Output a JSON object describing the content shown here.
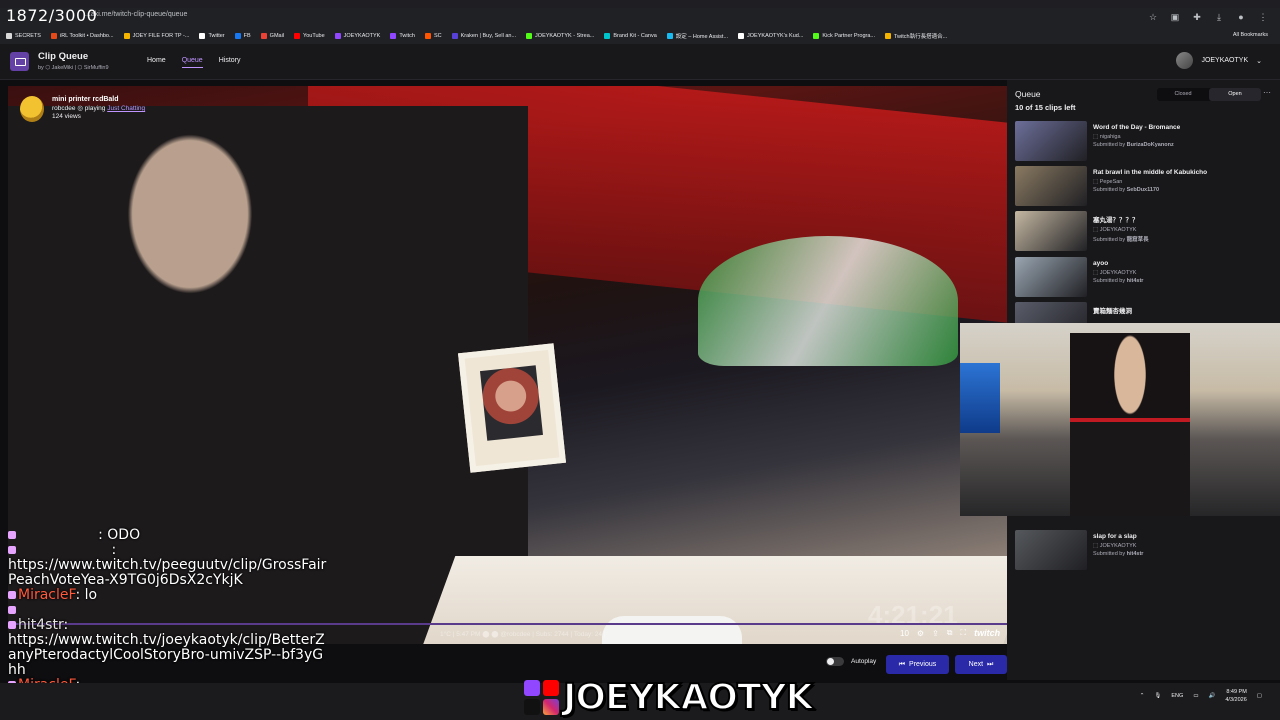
{
  "frame_counter": "1872/3000",
  "browser": {
    "url": "...aki.me/twitch-clip-queue/queue",
    "bookmarks": [
      {
        "label": "SECRETS",
        "color": "#d8d8d8"
      },
      {
        "label": "iRL Toolkit • Dashbo...",
        "color": "#e64a19"
      },
      {
        "label": "JOEY FILE FOR TP -...",
        "color": "#f5b400"
      },
      {
        "label": "Twitter",
        "color": "#ffffff"
      },
      {
        "label": "FB",
        "color": "#1877f2"
      },
      {
        "label": "GMail",
        "color": "#ea4335"
      },
      {
        "label": "YouTube",
        "color": "#ff0000"
      },
      {
        "label": "JOEYKAOTYK",
        "color": "#9146ff"
      },
      {
        "label": "Twitch",
        "color": "#9146ff"
      },
      {
        "label": "SC",
        "color": "#ff5500"
      },
      {
        "label": "Kraken | Buy, Sell an...",
        "color": "#5741d9"
      },
      {
        "label": "JOEYKAOTYK - Strea...",
        "color": "#53fc18"
      },
      {
        "label": "Brand Kit - Canva",
        "color": "#00c4cc"
      },
      {
        "label": "設定 – Home Assist...",
        "color": "#18bcf2"
      },
      {
        "label": "JOEYKAOTYK's Kud...",
        "color": "#ffffff"
      },
      {
        "label": "Kick Partner Progra...",
        "color": "#53fc18"
      },
      {
        "label": "Twitch執行長搭適合...",
        "color": "#f5b400"
      }
    ],
    "all_bookmarks": "All Bookmarks"
  },
  "app": {
    "title": "Clip Queue",
    "subtitle": "by ⬡ JakeMiki | ⬡ SirMuffin9",
    "nav": [
      {
        "label": "Home",
        "active": false
      },
      {
        "label": "Queue",
        "active": true
      },
      {
        "label": "History",
        "active": false
      }
    ],
    "user": "JOEYKAOTYK"
  },
  "player": {
    "clip_title": "mini printer rcdBald",
    "channel": "robcdee",
    "playing_prefix": "playing",
    "game": "Just Chatting",
    "views": "124 views",
    "overlay_time": "4:21:21",
    "status_strip": "1°C | 5:47 PM  ⬤  ⬤  @robcdee |  Subs: 2744  |  Today: 24  |",
    "control_count": "10",
    "brand": "twitch"
  },
  "chat": {
    "lines": [
      {
        "user": "",
        "text": "                  : ODO"
      },
      {
        "user": "                     ",
        "text": ":"
      },
      {
        "user": "",
        "text": "https://www.twitch.tv/peeguutv/clip/GrossFairPeachVoteYea-X9TG0j6DsX2cYkjK"
      },
      {
        "user": "MiracleF",
        "text": ": lo"
      },
      {
        "user": "                  ",
        "text": ""
      },
      {
        "user": "hit4str",
        "text": ":"
      },
      {
        "user": "",
        "text": "https://www.twitch.tv/joeykaotyk/clip/BetterZanyPterodactylCoolStoryBro-umivZSP--bf3yGhh"
      },
      {
        "user": "MiracleF",
        "text": ":"
      }
    ],
    "ghost_caption": "mini printer rcdBald"
  },
  "queue": {
    "title": "Queue",
    "count": "10 of 15 clips left",
    "toggle_closed": "Closed",
    "toggle_open": "Open",
    "items": [
      {
        "title": "Word of the Day - Bromance",
        "channel": "nigahiga",
        "submitted_prefix": "Submitted by",
        "submitter": "BurizaDoKyanonz",
        "thumb": "#6d6f9a"
      },
      {
        "title": "Rat brawl in the middle of Kabukicho",
        "channel": "PepeSan",
        "submitted_prefix": "Submitted by",
        "submitter": "SebDux1170",
        "thumb": "#8a7a62"
      },
      {
        "title": "塞丸湯？？？？",
        "channel": "JOEYKAOTYK",
        "submitted_prefix": "Submitted by",
        "submitter": "龍窟草長",
        "thumb": "#c5b8a2"
      },
      {
        "title": "ayoo",
        "channel": "JOEYKAOTYK",
        "submitted_prefix": "Submitted by",
        "submitter": "hit4str",
        "thumb": "#9aa6b2"
      },
      {
        "title": "賣箱麵杏幾洞",
        "channel": "",
        "submitted_prefix": "",
        "submitter": "",
        "thumb": "#5a5d6a"
      },
      {
        "title": "slap for a slap",
        "channel": "JOEYKAOTYK",
        "submitted_prefix": "Submitted by",
        "submitter": "hit4str",
        "thumb": "#55585c"
      }
    ]
  },
  "controls": {
    "autoplay": "Autoplay",
    "previous": "Previous",
    "next": "Next"
  },
  "taskbar": {
    "lang": "ENG",
    "time": "8:49 PM",
    "date": "4/3/2026"
  },
  "streamer_logo": "JOEYKAOTYK",
  "colors": {
    "accent": "#bf94ff",
    "button": "#2a2aa8",
    "twitch": "#9146ff"
  }
}
